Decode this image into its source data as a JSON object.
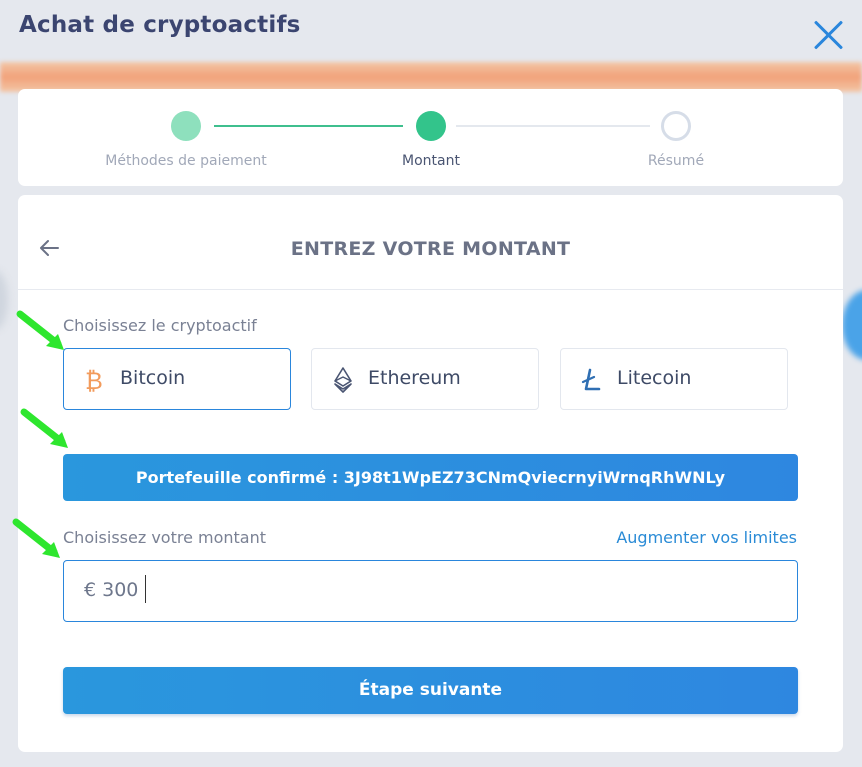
{
  "window": {
    "title": "Achat de cryptoactifs"
  },
  "stepper": {
    "steps": [
      {
        "label": "Méthodes de paiement",
        "state": "completed"
      },
      {
        "label": "Montant",
        "state": "active"
      },
      {
        "label": "Résumé",
        "state": "pending"
      }
    ]
  },
  "card": {
    "title": "ENTREZ VOTRE MONTANT",
    "crypto_label": "Choisissez le cryptoactif",
    "crypto_options": [
      {
        "name": "Bitcoin",
        "icon": "bitcoin-icon",
        "selected": true
      },
      {
        "name": "Ethereum",
        "icon": "ethereum-icon",
        "selected": false
      },
      {
        "name": "Litecoin",
        "icon": "litecoin-icon",
        "selected": false
      }
    ],
    "wallet_confirmation": "Portefeuille confirmé : 3J98t1WpEZ73CNmQviecrnyiWrnqRhWNLy",
    "amount_label": "Choisissez votre montant",
    "limits_link": "Augmenter vos limites",
    "amount_value": "€ 300",
    "next_button": "Étape suivante"
  },
  "colors": {
    "accent": "#2a86dc",
    "step_active": "#33c48b",
    "step_completed": "#8ee0bd",
    "bitcoin": "#f29b5c",
    "annotation_arrow": "#2ee62e"
  }
}
